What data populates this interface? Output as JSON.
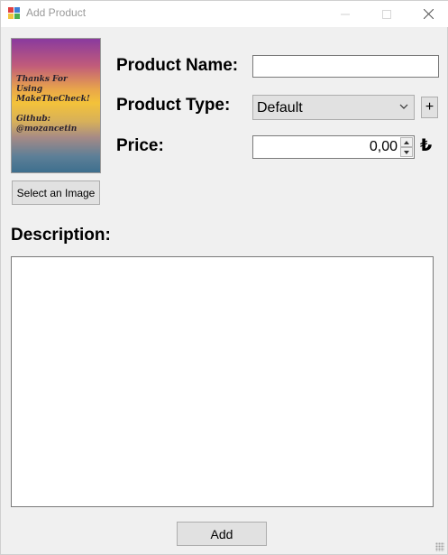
{
  "window": {
    "title": "Add Product",
    "icons": {
      "app": "app-icon",
      "minimize": "minimize-icon",
      "maximize": "maximize-icon",
      "close": "close-icon"
    }
  },
  "image_panel": {
    "preview_text": "Thanks For\nUsing\nMakeTheCheck!\n\nGithub:\n@mozancetin",
    "select_button_label": "Select an Image"
  },
  "form": {
    "name_label": "Product Name:",
    "name_value": "",
    "type_label": "Product Type:",
    "type_selected": "Default",
    "add_type_button": "+",
    "price_label": "Price:",
    "price_value": "0,00",
    "currency_symbol": "₺",
    "description_label": "Description:",
    "description_value": ""
  },
  "actions": {
    "add_label": "Add"
  },
  "colors": {
    "window_bg": "#f0f0f0",
    "button_bg": "#e1e1e1"
  }
}
